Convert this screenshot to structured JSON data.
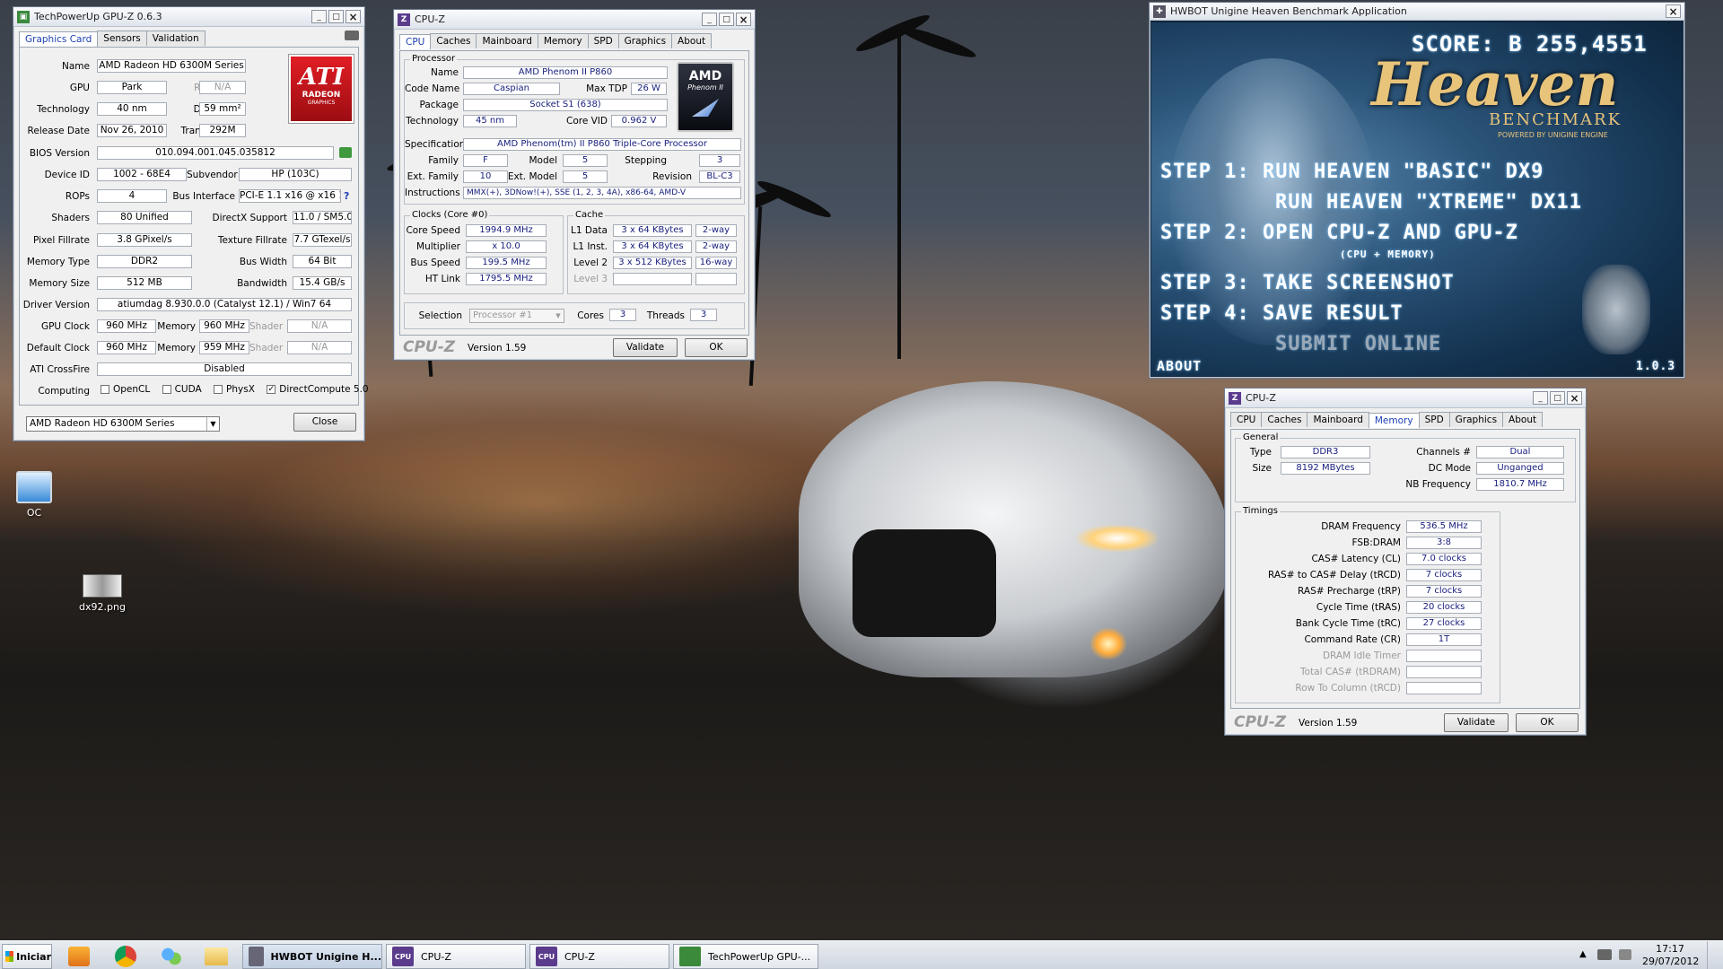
{
  "desktop": {
    "icons": [
      {
        "label": "OC"
      },
      {
        "label": "dx92.png"
      }
    ]
  },
  "gpuz": {
    "title": "TechPowerUp GPU-Z 0.6.3",
    "tabs": [
      "Graphics Card",
      "Sensors",
      "Validation"
    ],
    "labels": {
      "name": "Name",
      "gpu": "GPU",
      "revision": "Revision",
      "technology": "Technology",
      "die_size": "Die Size",
      "release_date": "Release Date",
      "transistors": "Transistors",
      "bios": "BIOS Version",
      "device_id": "Device ID",
      "subvendor": "Subvendor",
      "rops": "ROPs",
      "bus_interface": "Bus Interface",
      "shaders": "Shaders",
      "directx": "DirectX Support",
      "pixel_fill": "Pixel Fillrate",
      "texture_fill": "Texture Fillrate",
      "memory_type": "Memory Type",
      "bus_width": "Bus Width",
      "memory_size": "Memory Size",
      "bandwidth": "Bandwidth",
      "driver": "Driver Version",
      "gpu_clock": "GPU Clock",
      "memory": "Memory",
      "shader": "Shader",
      "default_clock": "Default Clock",
      "crossfire": "ATI CrossFire",
      "computing": "Computing"
    },
    "values": {
      "name": "AMD Radeon HD 6300M Series",
      "gpu": "Park",
      "revision": "N/A",
      "technology": "40 nm",
      "die_size": "59 mm²",
      "release_date": "Nov 26, 2010",
      "transistors": "292M",
      "bios": "010.094.001.045.035812",
      "device_id": "1002 - 68E4",
      "subvendor": "HP (103C)",
      "rops": "4",
      "bus_interface": "PCI-E 1.1 x16 @ x16 1.1",
      "shaders": "80 Unified",
      "directx": "11.0 / SM5.0",
      "pixel_fill": "3.8 GPixel/s",
      "texture_fill": "7.7 GTexel/s",
      "memory_type": "DDR2",
      "bus_width": "64 Bit",
      "memory_size": "512 MB",
      "bandwidth": "15.4 GB/s",
      "driver": "atiumdag 8.930.0.0 (Catalyst 12.1) / Win7 64",
      "gpu_clock": "960 MHz",
      "gpu_mem": "960 MHz",
      "gpu_shader": "N/A",
      "def_clock": "960 MHz",
      "def_mem": "959 MHz",
      "def_shader": "N/A",
      "crossfire": "Disabled"
    },
    "computing": [
      {
        "label": "OpenCL",
        "checked": false
      },
      {
        "label": "CUDA",
        "checked": false
      },
      {
        "label": "PhysX",
        "checked": false
      },
      {
        "label": "DirectCompute 5.0",
        "checked": true
      }
    ],
    "logo_text": "ATI",
    "logo_sub": "RADEON",
    "logo_sub2": "GRAPHICS",
    "dropdown": "AMD Radeon HD 6300M Series",
    "close": "Close",
    "help": "?"
  },
  "cpuz1": {
    "title": "CPU-Z",
    "tabs": [
      "CPU",
      "Caches",
      "Mainboard",
      "Memory",
      "SPD",
      "Graphics",
      "About"
    ],
    "processor": "Processor",
    "labels": {
      "name": "Name",
      "code_name": "Code Name",
      "max_tdp": "Max TDP",
      "package": "Package",
      "technology": "Technology",
      "core_vid": "Core VID",
      "specification": "Specification",
      "family": "Family",
      "model": "Model",
      "stepping": "Stepping",
      "ext_family": "Ext. Family",
      "ext_model": "Ext. Model",
      "revision": "Revision",
      "instructions": "Instructions",
      "clocks": "Clocks (Core #0)",
      "core_speed": "Core Speed",
      "multiplier": "Multiplier",
      "bus_speed": "Bus Speed",
      "ht_link": "HT Link",
      "cache": "Cache",
      "l1d": "L1 Data",
      "l1i": "L1 Inst.",
      "l2": "Level 2",
      "l3": "Level 3",
      "selection": "Selection",
      "cores": "Cores",
      "threads": "Threads"
    },
    "values": {
      "name": "AMD Phenom II P860",
      "code_name": "Caspian",
      "max_tdp": "26 W",
      "package": "Socket S1 (638)",
      "technology": "45 nm",
      "core_vid": "0.962 V",
      "specification": "AMD Phenom(tm) II P860 Triple-Core Processor",
      "family": "F",
      "model": "5",
      "stepping": "3",
      "ext_family": "10",
      "ext_model": "5",
      "revision": "BL-C3",
      "instructions": "MMX(+), 3DNow!(+), SSE (1, 2, 3, 4A), x86-64, AMD-V",
      "core_speed": "1994.9 MHz",
      "multiplier": "x 10.0",
      "bus_speed": "199.5 MHz",
      "ht_link": "1795.5 MHz",
      "l1d": "3 x 64 KBytes",
      "l1d_way": "2-way",
      "l1i": "3 x 64 KBytes",
      "l1i_way": "2-way",
      "l2": "3 x 512 KBytes",
      "l2_way": "16-way",
      "selection": "Processor #1",
      "cores": "3",
      "threads": "3"
    },
    "logo_brand": "AMD",
    "logo_model": "Phenom II",
    "brand": "CPU-Z",
    "version": "Version 1.59",
    "validate": "Validate",
    "ok": "OK"
  },
  "heaven": {
    "title": "HWBOT Unigine Heaven Benchmark Application",
    "score": "SCORE: B 255,4551",
    "logo": "Heaven",
    "logo_sub": "BENCHMARK",
    "logo_powered": "POWERED BY UNIGINE ENGINE",
    "lines": [
      "STEP 1:  RUN HEAVEN \"BASIC\" DX9",
      "RUN HEAVEN \"XTREME\" DX11",
      "STEP 2: OPEN CPU-Z  AND  GPU-Z",
      "(CPU + MEMORY)",
      "STEP 3: TAKE SCREENSHOT",
      "STEP 4: SAVE RESULT",
      "SUBMIT ONLINE"
    ],
    "about": "ABOUT",
    "version": "1.0.3"
  },
  "cpuz2": {
    "title": "CPU-Z",
    "tabs": [
      "CPU",
      "Caches",
      "Mainboard",
      "Memory",
      "SPD",
      "Graphics",
      "About"
    ],
    "general": "General",
    "labels": {
      "type": "Type",
      "size": "Size",
      "channels": "Channels #",
      "dc_mode": "DC Mode",
      "nb_freq": "NB Frequency",
      "timings": "Timings",
      "dram_freq": "DRAM Frequency",
      "fsb_dram": "FSB:DRAM",
      "cas": "CAS# Latency (CL)",
      "rcd": "RAS# to CAS# Delay (tRCD)",
      "rp": "RAS# Precharge (tRP)",
      "ras": "Cycle Time (tRAS)",
      "rc": "Bank Cycle Time (tRC)",
      "cr": "Command Rate (CR)",
      "idle": "DRAM Idle Timer",
      "trdram": "Total CAS# (tRDRAM)",
      "trcd": "Row To Column (tRCD)"
    },
    "values": {
      "type": "DDR3",
      "size": "8192 MBytes",
      "channels": "Dual",
      "dc_mode": "Unganged",
      "nb_freq": "1810.7 MHz",
      "dram_freq": "536.5 MHz",
      "fsb_dram": "3:8",
      "cas": "7.0 clocks",
      "rcd": "7 clocks",
      "rp": "7 clocks",
      "ras": "20 clocks",
      "rc": "27 clocks",
      "cr": "1T"
    },
    "brand": "CPU-Z",
    "version": "Version 1.59",
    "validate": "Validate",
    "ok": "OK"
  },
  "taskbar": {
    "start": "Iniciar",
    "buttons": [
      "HWBOT Unigine H...",
      "CPU-Z",
      "CPU-Z",
      "TechPowerUp GPU-..."
    ],
    "time": "17:17",
    "date": "29/07/2012"
  }
}
